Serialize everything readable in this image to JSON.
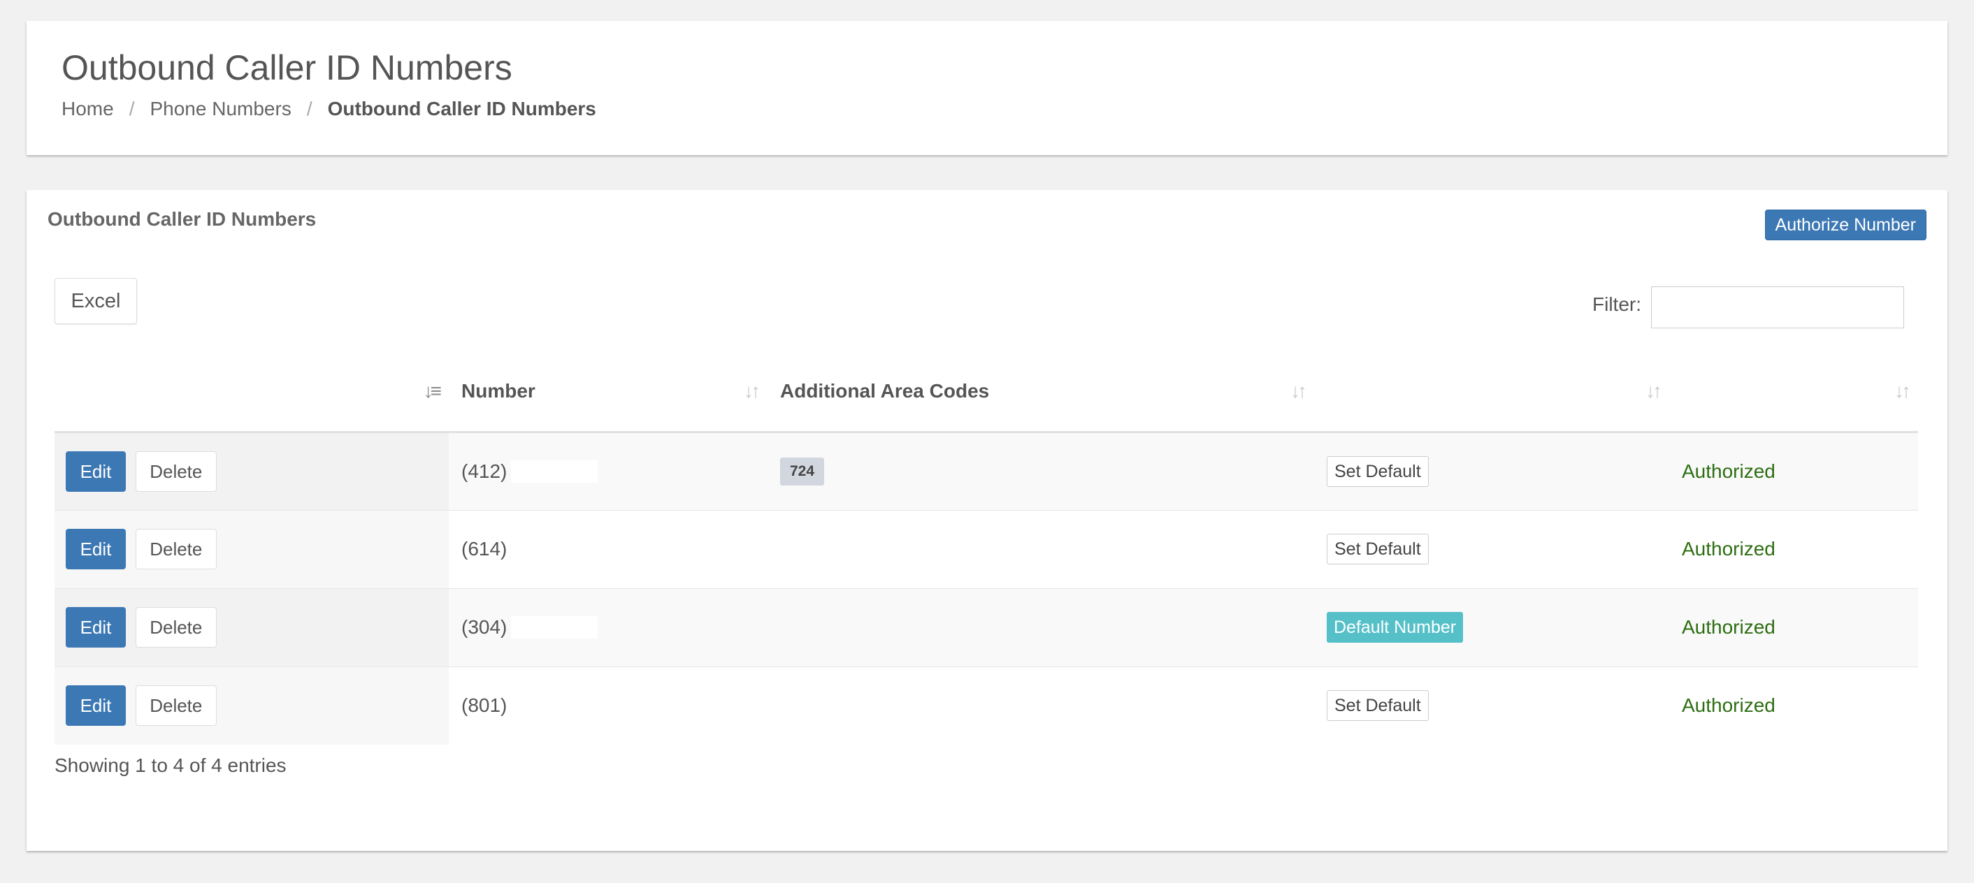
{
  "header": {
    "title": "Outbound Caller ID Numbers",
    "breadcrumb": [
      {
        "label": "Home"
      },
      {
        "label": "Phone Numbers"
      },
      {
        "label": "Outbound Caller ID Numbers"
      }
    ],
    "separator": "/"
  },
  "box": {
    "title": "Outbound Caller ID Numbers",
    "authorize_label": "Authorize Number",
    "excel_label": "Excel",
    "filter_label": "Filter:",
    "filter_value": ""
  },
  "table": {
    "columns": [
      "",
      "Number",
      "Additional Area Codes",
      "",
      ""
    ],
    "sort_icon": "sort-arrows-icon",
    "rows": [
      {
        "edit": "Edit",
        "delete": "Delete",
        "number": "(412)",
        "area_code": "724",
        "default_action": "Set Default",
        "status": "Authorized"
      },
      {
        "edit": "Edit",
        "delete": "Delete",
        "number": "(614)",
        "area_code": "",
        "default_action": "Set Default",
        "status": "Authorized"
      },
      {
        "edit": "Edit",
        "delete": "Delete",
        "number": "(304)",
        "area_code": "",
        "default_action": "Default Number",
        "status": "Authorized"
      },
      {
        "edit": "Edit",
        "delete": "Delete",
        "number": "(801)",
        "area_code": "",
        "default_action": "Set Default",
        "status": "Authorized"
      }
    ]
  },
  "footer": {
    "info": "Showing 1 to 4 of 4 entries"
  },
  "colors": {
    "primary": "#3c78b4",
    "default_badge": "#55c0c8",
    "authorized": "#2d6e12"
  }
}
